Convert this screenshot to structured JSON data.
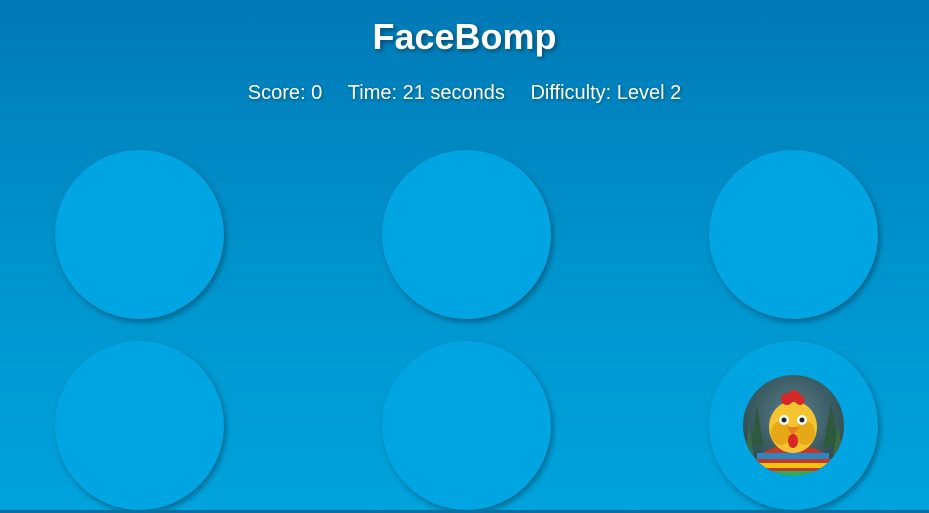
{
  "game": {
    "title": "FaceBomp"
  },
  "stats": {
    "score": "Score: 0",
    "time": "Time: 21 seconds",
    "difficulty": "Difficulty: Level 2"
  },
  "board": {
    "holes": 6,
    "active_hole": 6,
    "active_face": "rooster-face-icon"
  },
  "colors": {
    "hole": "#00a5e2",
    "background_top": "#0079b6",
    "background_bottom": "#00a3dd"
  }
}
